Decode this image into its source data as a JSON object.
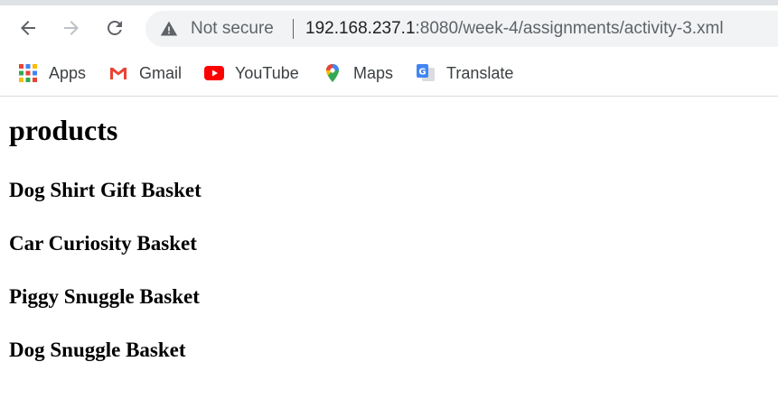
{
  "browser": {
    "security_label": "Not secure",
    "url_host": "192.168.237.1",
    "url_rest": ":8080/week-4/assignments/activity-3.xml",
    "bookmarks": [
      {
        "label": "Apps",
        "icon": "apps-grid-icon"
      },
      {
        "label": "Gmail",
        "icon": "gmail-icon"
      },
      {
        "label": "YouTube",
        "icon": "youtube-icon"
      },
      {
        "label": "Maps",
        "icon": "maps-icon"
      },
      {
        "label": "Translate",
        "icon": "translate-icon"
      }
    ]
  },
  "page": {
    "heading": "products",
    "products": [
      "Dog Shirt Gift Basket",
      "Car Curiosity Basket",
      "Piggy Snuggle Basket",
      "Dog Snuggle Basket"
    ]
  },
  "colors": {
    "tab_strip": "#dee1e6",
    "omnibox_bg": "#f1f3f4",
    "url_host": "#202124",
    "url_muted": "#5f6368",
    "youtube_red": "#ff0000"
  }
}
